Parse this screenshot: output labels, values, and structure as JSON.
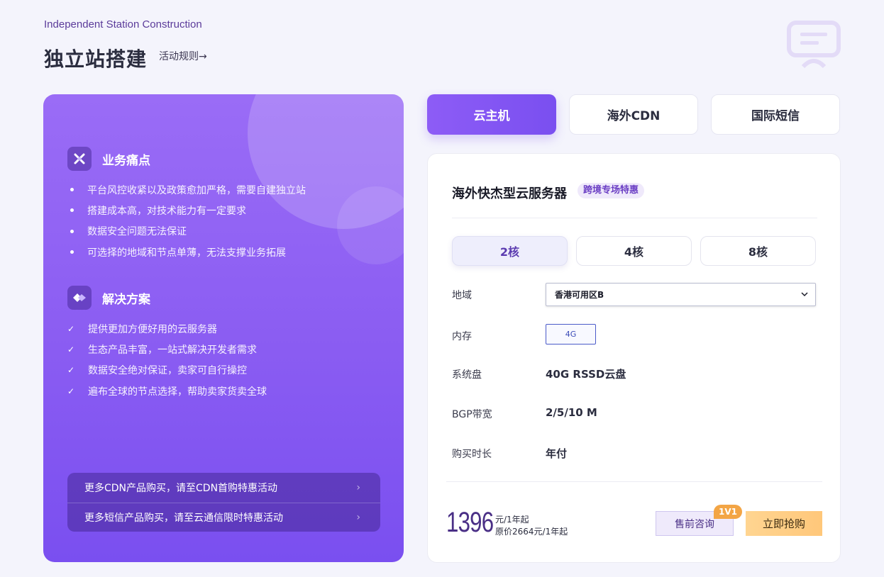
{
  "header": {
    "eyebrow": "Independent Station Construction",
    "title": "独立站搭建",
    "rules_link": "活动规则→"
  },
  "left": {
    "pain": {
      "title": "业务痛点",
      "items": [
        "平台风控收紧以及政策愈加严格，需要自建独立站",
        "搭建成本高，对技术能力有一定要求",
        "数据安全问题无法保证",
        "可选择的地域和节点单薄，无法支撑业务拓展"
      ]
    },
    "solution": {
      "title": "解决方案",
      "items": [
        "提供更加方便好用的云服务器",
        "生态产品丰富，一站式解决开发者需求",
        "数据安全绝对保证，卖家可自行操控",
        "遍布全球的节点选择，帮助卖家货卖全球"
      ]
    },
    "links": [
      {
        "label": "更多CDN产品购买，请至CDN首购特惠活动",
        "chevron": "›"
      },
      {
        "label": "更多短信产品购买，请至云通信限时特惠活动",
        "chevron": "›"
      }
    ]
  },
  "tabs": [
    {
      "label": "云主机",
      "active": true
    },
    {
      "label": "海外CDN",
      "active": false
    },
    {
      "label": "国际短信",
      "active": false
    }
  ],
  "product": {
    "title": "海外快杰型云服务器",
    "tag": "跨境专场特惠",
    "cores": [
      {
        "label": "2核",
        "active": true
      },
      {
        "label": "4核",
        "active": false
      },
      {
        "label": "8核",
        "active": false
      }
    ],
    "specs": {
      "region_label": "地域",
      "region_value": "香港可用区B",
      "memory_label": "内存",
      "memory_value": "4G",
      "disk_label": "系统盘",
      "disk_value": "40G RSSD云盘",
      "bandwidth_label": "BGP带宽",
      "bandwidth_value": "2/5/10 M",
      "duration_label": "购买时长",
      "duration_value": "年付"
    },
    "price": {
      "amount": "1396",
      "unit": "元/1年起",
      "original": "原价2664元/1年起"
    },
    "consult_label": "售前咨询",
    "consult_badge": "1V1",
    "buy_label": "立即抢购"
  },
  "colors": {
    "accent": "#7a4ff0",
    "price": "#4a2f86",
    "buy": "#ffc77a",
    "badge": "#f3a545"
  }
}
